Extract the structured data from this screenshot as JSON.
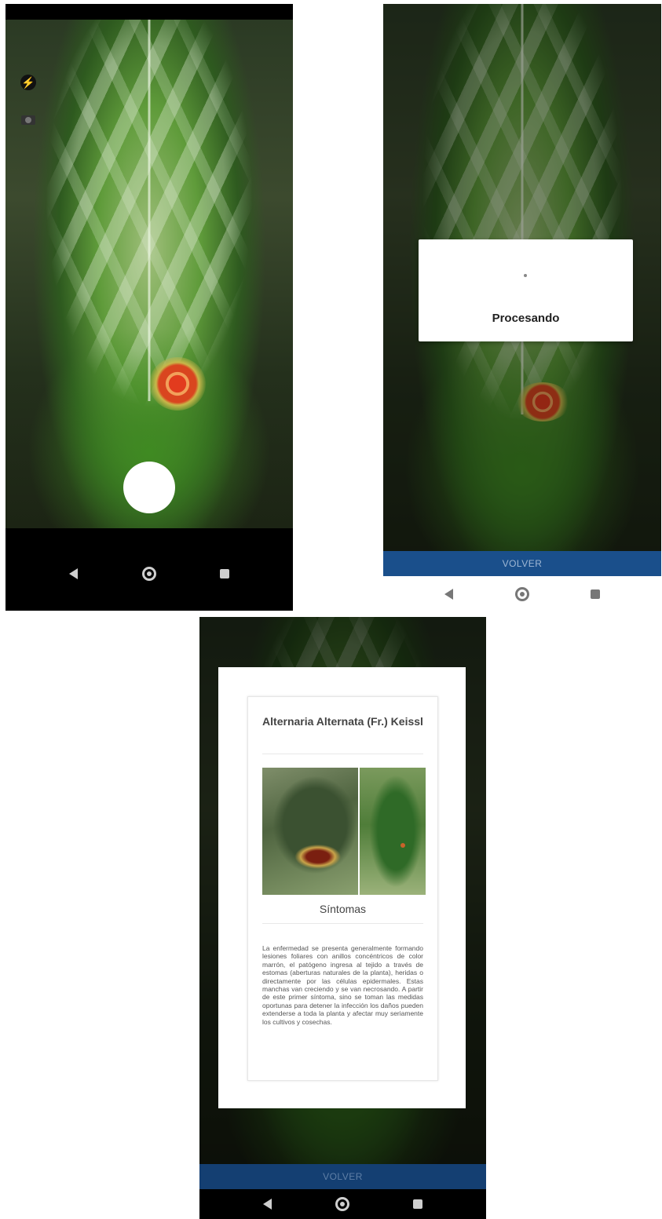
{
  "screen_capture": {
    "flash_icon": "flash-icon",
    "switch_camera_icon": "camera-switch-icon",
    "shutter_icon": "shutter-button",
    "nav": {
      "back": "back-icon",
      "home": "home-icon",
      "recents": "recents-icon"
    }
  },
  "screen_processing": {
    "dialog": {
      "text": "Procesando"
    },
    "volver_label": "VOLVER"
  },
  "screen_result": {
    "disease_title": "Alternaria Alternata (Fr.) Keissl",
    "section_title": "Síntomas",
    "description": "La enfermedad se presenta generalmente formando lesiones foliares con anillos concéntricos de color marrón, el patógeno ingresa al tejido a través de estomas (aberturas naturales de la planta), heridas o directamente por las células epidermales. Estas manchas van creciendo y se van necrosando. A partir de este primer síntoma, sino se toman las medidas oportunas para detener la infección los daños pueden extenderse a toda la planta y afectar muy seriamente los cultivos y cosechas.",
    "volver_label": "VOLVER"
  },
  "colors": {
    "volver_bar": "#1a4f8b",
    "flash_icon": "#f5c400",
    "lesion": "#e23b1e"
  }
}
